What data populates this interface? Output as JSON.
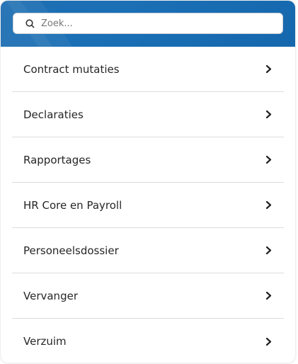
{
  "search": {
    "placeholder": "Zoek..."
  },
  "menu": {
    "items": [
      {
        "label": "Contract mutaties"
      },
      {
        "label": "Declaraties"
      },
      {
        "label": "Rapportages"
      },
      {
        "label": "HR Core en Payroll"
      },
      {
        "label": "Personeelsdossier"
      },
      {
        "label": "Vervanger"
      },
      {
        "label": "Verzuim"
      }
    ]
  },
  "icons": {
    "search": "search-icon",
    "chevron": "chevron-right-icon"
  },
  "colors": {
    "header": "#1a6fb5",
    "divider": "#dcdcdc",
    "text": "#262626"
  }
}
